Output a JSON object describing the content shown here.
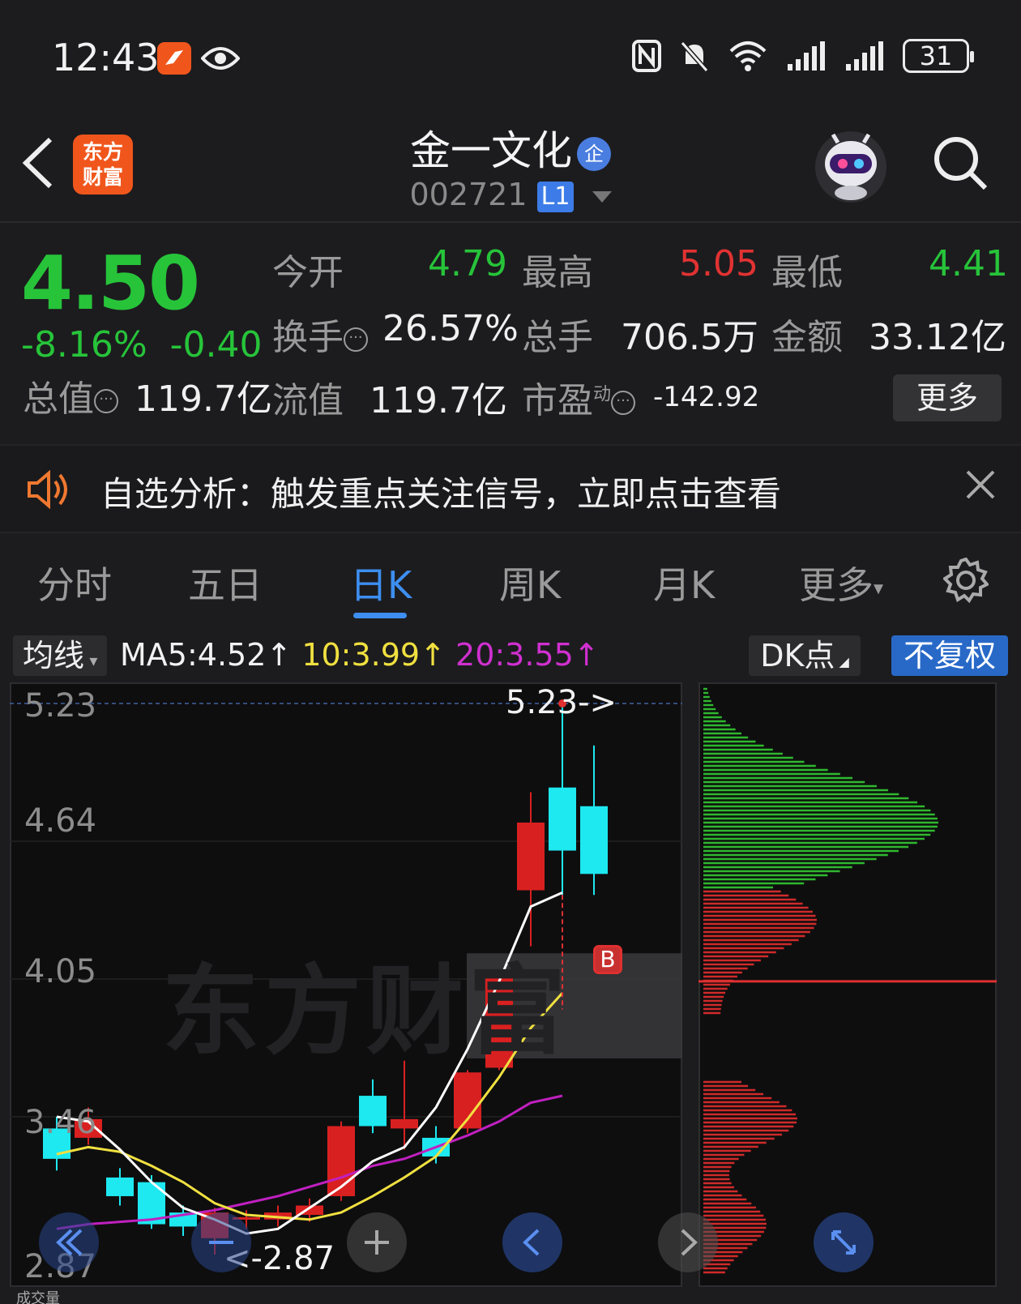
{
  "status_bar": {
    "time": "12:43",
    "battery": "31",
    "icons": [
      "app-notification-icon",
      "eye-icon",
      "nfc-icon",
      "mute-icon",
      "wifi-icon",
      "signal-icon",
      "signal-icon"
    ]
  },
  "header": {
    "app_logo_text": "东方\n财富",
    "stock_name": "金一文化",
    "badge": "企",
    "stock_code": "002721",
    "level": "L1"
  },
  "quote": {
    "price": "4.50",
    "change_pct": "-8.16%",
    "change_abs": "-0.40",
    "open_label": "今开",
    "open": "4.79",
    "high_label": "最高",
    "high": "5.05",
    "low_label": "最低",
    "low": "4.41",
    "turnover_label": "换手",
    "turnover": "26.57%",
    "volume_label": "总手",
    "volume": "706.5万",
    "amount_label": "金额",
    "amount": "33.12亿",
    "mktcap_label": "总值",
    "mktcap": "119.7亿",
    "float_label": "流值",
    "float_cap": "119.7亿",
    "pe_label": "市盈",
    "pe_sup": "动",
    "pe": "-142.92",
    "more_label": "更多"
  },
  "notice": {
    "text": "自选分析：触发重点关注信号，立即点击查看"
  },
  "tabs": [
    "分时",
    "五日",
    "日K",
    "周K",
    "月K",
    "更多"
  ],
  "active_tab": "日K",
  "chart_toolbar": {
    "ma_button": "均线",
    "ma5": "MA5:4.52↑",
    "ma10": "10:3.99↑",
    "ma20": "20:3.55↑",
    "dk_button": "DK点",
    "adjust_button": "不复权"
  },
  "chart": {
    "y_ticks": [
      "5.23",
      "4.64",
      "4.05",
      "3.46",
      "2.87"
    ],
    "high_marker": "5.23->",
    "low_marker": "<-2.87",
    "buy_marker": "B",
    "watermark": "东方财富",
    "colors": {
      "up": "#d92020",
      "down": "#1ee8f0",
      "ma5": "#ffffff",
      "ma10": "#f0e040",
      "ma20": "#c020c0"
    }
  },
  "chart_data": {
    "type": "candlestick",
    "ylim": [
      2.87,
      5.23
    ],
    "candles": [
      {
        "o": 3.41,
        "c": 3.28,
        "h": 3.46,
        "l": 3.23
      },
      {
        "o": 3.37,
        "c": 3.45,
        "h": 3.5,
        "l": 3.34
      },
      {
        "o": 3.2,
        "c": 3.12,
        "h": 3.24,
        "l": 3.08
      },
      {
        "o": 3.18,
        "c": 3.0,
        "h": 3.21,
        "l": 2.98
      },
      {
        "o": 3.05,
        "c": 2.99,
        "h": 3.08,
        "l": 2.95
      },
      {
        "o": 2.94,
        "c": 3.05,
        "h": 3.07,
        "l": 2.87
      },
      {
        "o": 3.02,
        "c": 3.03,
        "h": 3.06,
        "l": 2.98
      },
      {
        "o": 3.02,
        "c": 3.05,
        "h": 3.08,
        "l": 2.99
      },
      {
        "o": 3.04,
        "c": 3.08,
        "h": 3.11,
        "l": 3.01
      },
      {
        "o": 3.12,
        "c": 3.42,
        "h": 3.44,
        "l": 3.1
      },
      {
        "o": 3.55,
        "c": 3.42,
        "h": 3.62,
        "l": 3.39
      },
      {
        "o": 3.41,
        "c": 3.45,
        "h": 3.7,
        "l": 3.32
      },
      {
        "o": 3.37,
        "c": 3.29,
        "h": 3.42,
        "l": 3.26
      },
      {
        "o": 3.41,
        "c": 3.65,
        "h": 3.66,
        "l": 3.39
      },
      {
        "o": 3.67,
        "c": 4.07,
        "h": 4.07,
        "l": 3.66
      },
      {
        "o": 4.43,
        "c": 4.72,
        "h": 4.85,
        "l": 4.19
      },
      {
        "o": 4.87,
        "c": 4.6,
        "h": 5.23,
        "l": 4.41
      },
      {
        "o": 4.79,
        "c": 4.5,
        "h": 5.05,
        "l": 4.41
      }
    ],
    "ma5": [
      3.46,
      3.44,
      3.32,
      3.18,
      3.07,
      3.02,
      2.96,
      2.98,
      3.07,
      3.16,
      3.27,
      3.33,
      3.5,
      3.75,
      4.04,
      4.36,
      4.42
    ],
    "ma10": [
      3.3,
      3.33,
      3.31,
      3.25,
      3.18,
      3.09,
      3.04,
      3.03,
      3.02,
      3.05,
      3.12,
      3.2,
      3.29,
      3.45,
      3.63,
      3.84,
      3.99
    ],
    "ma20": [
      2.98,
      3.0,
      3.01,
      3.02,
      3.04,
      3.06,
      3.09,
      3.12,
      3.16,
      3.2,
      3.25,
      3.28,
      3.33,
      3.38,
      3.44,
      3.52,
      3.55
    ],
    "chip_range_note": "",
    "volume_profile": {
      "current_price": 4.04
    }
  },
  "bottom_strip": {
    "volume_label": "成交量"
  }
}
